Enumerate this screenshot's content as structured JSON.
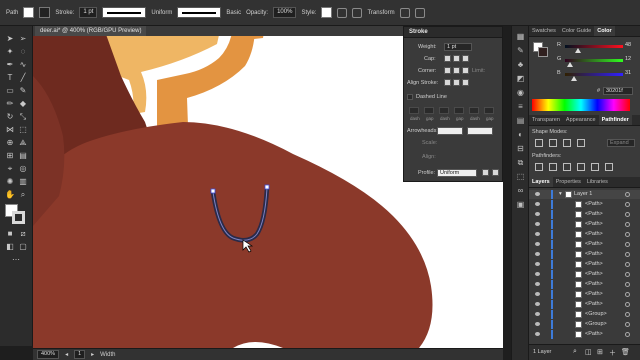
{
  "control_bar": {
    "object_type": "Path",
    "stroke_label": "Stroke:",
    "stroke_weight": "1 pt",
    "profile": "Uniform",
    "brush": "Basic",
    "opacity_label": "Opacity:",
    "opacity_value": "100%",
    "style_label": "Style:",
    "transform_label": "Transform"
  },
  "document": {
    "tab_label": "deer.ai* @ 400% (RGB/GPU Preview)"
  },
  "status_bar": {
    "zoom": "400%",
    "artboard": "1",
    "tool": "Width"
  },
  "stroke_panel": {
    "title": "Stroke",
    "weight_label": "Weight:",
    "weight_value": "1 pt",
    "cap_label": "Cap:",
    "corner_label": "Corner:",
    "limit_label": "Limit:",
    "align_label": "Align Stroke:",
    "dashed_label": "Dashed Line",
    "dash_labels": [
      "dash",
      "gap",
      "dash",
      "gap",
      "dash",
      "gap"
    ],
    "arrowheads_label": "Arrowheads:",
    "scale_label": "Scale:",
    "align2_label": "Align:",
    "profile_label": "Profile:",
    "profile_value": "Uniform"
  },
  "color_panel": {
    "tabs": [
      "Swatches",
      "Color Guide",
      "Color"
    ],
    "active_tab": "Color",
    "r_label": "R",
    "r_value": "48",
    "g_label": "G",
    "g_value": "12",
    "b_label": "B",
    "b_value": "31",
    "hex_value": "30201f",
    "current_color": "#30201f"
  },
  "pathfinder_panel": {
    "tabs": [
      "Transparen",
      "Appearance",
      "Pathfinder"
    ],
    "active_tab": "Pathfinder",
    "shape_modes_label": "Shape Modes:",
    "pathfinders_label": "Pathfinders:",
    "expand_label": "Expand"
  },
  "layers_panel": {
    "tabs": [
      "Layers",
      "Properties",
      "Libraries"
    ],
    "active_tab": "Layers",
    "layer_name": "Layer 1",
    "items": [
      "<Path>",
      "<Path>",
      "<Path>",
      "<Path>",
      "<Path>",
      "<Path>",
      "<Path>",
      "<Path>",
      "<Path>",
      "<Path>",
      "<Path>",
      "<Group>",
      "<Group>",
      "<Path>"
    ],
    "footer": "1 Layer"
  },
  "colors": {
    "deer_body": "#8b392a",
    "deer_dark": "#6e2a1f",
    "antler_light": "#efb664",
    "antler_orange": "#e39441",
    "selection_stroke": "#3b3a5a",
    "accent": "#3d7bd9"
  }
}
